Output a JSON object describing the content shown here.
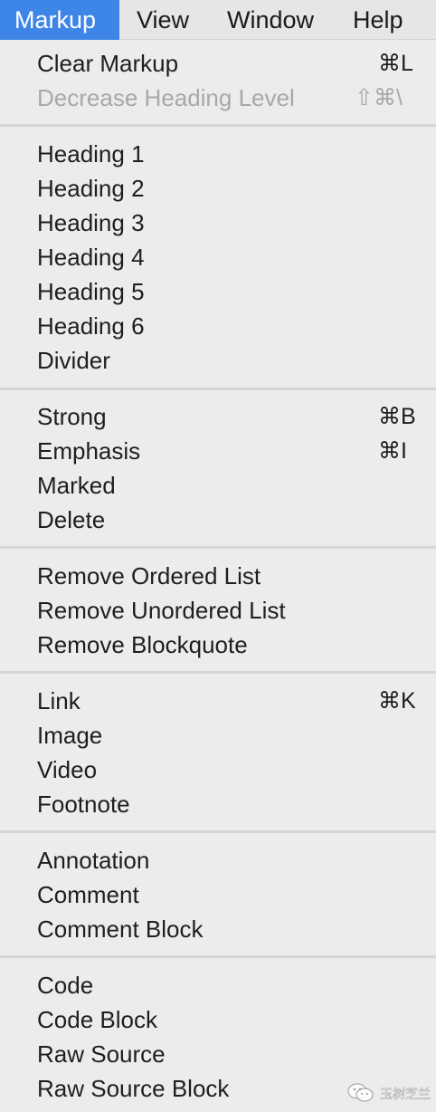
{
  "menubar": {
    "items": [
      "Markup",
      "View",
      "Window",
      "Help"
    ]
  },
  "menu": {
    "clear_markup": {
      "label": "Clear Markup",
      "shortcut": "⌘L"
    },
    "decrease_heading": {
      "label": "Decrease Heading Level",
      "shortcut": "⇧⌘\\"
    },
    "heading_1": {
      "label": "Heading 1"
    },
    "heading_2": {
      "label": "Heading 2"
    },
    "heading_3": {
      "label": "Heading 3"
    },
    "heading_4": {
      "label": "Heading 4"
    },
    "heading_5": {
      "label": "Heading 5"
    },
    "heading_6": {
      "label": "Heading 6"
    },
    "divider": {
      "label": "Divider"
    },
    "strong": {
      "label": "Strong",
      "shortcut": "⌘B"
    },
    "emphasis": {
      "label": "Emphasis",
      "shortcut": "⌘I"
    },
    "marked": {
      "label": "Marked"
    },
    "delete": {
      "label": "Delete"
    },
    "remove_ordered_list": {
      "label": "Remove Ordered List"
    },
    "remove_unordered_list": {
      "label": "Remove Unordered List"
    },
    "remove_blockquote": {
      "label": "Remove Blockquote"
    },
    "link": {
      "label": "Link",
      "shortcut": "⌘K"
    },
    "image": {
      "label": "Image"
    },
    "video": {
      "label": "Video"
    },
    "footnote": {
      "label": "Footnote"
    },
    "annotation": {
      "label": "Annotation"
    },
    "comment": {
      "label": "Comment"
    },
    "comment_block": {
      "label": "Comment Block"
    },
    "code": {
      "label": "Code"
    },
    "code_block": {
      "label": "Code Block"
    },
    "raw_source": {
      "label": "Raw Source"
    },
    "raw_source_block": {
      "label": "Raw Source Block"
    }
  },
  "watermark": {
    "icon": "wechat-icon",
    "text": "玉树芝兰"
  },
  "colors": {
    "menubar_active": "#3d86e8",
    "menu_background": "#ececec",
    "disabled_text": "#a8a8a8",
    "separator": "#d6d6d6"
  }
}
